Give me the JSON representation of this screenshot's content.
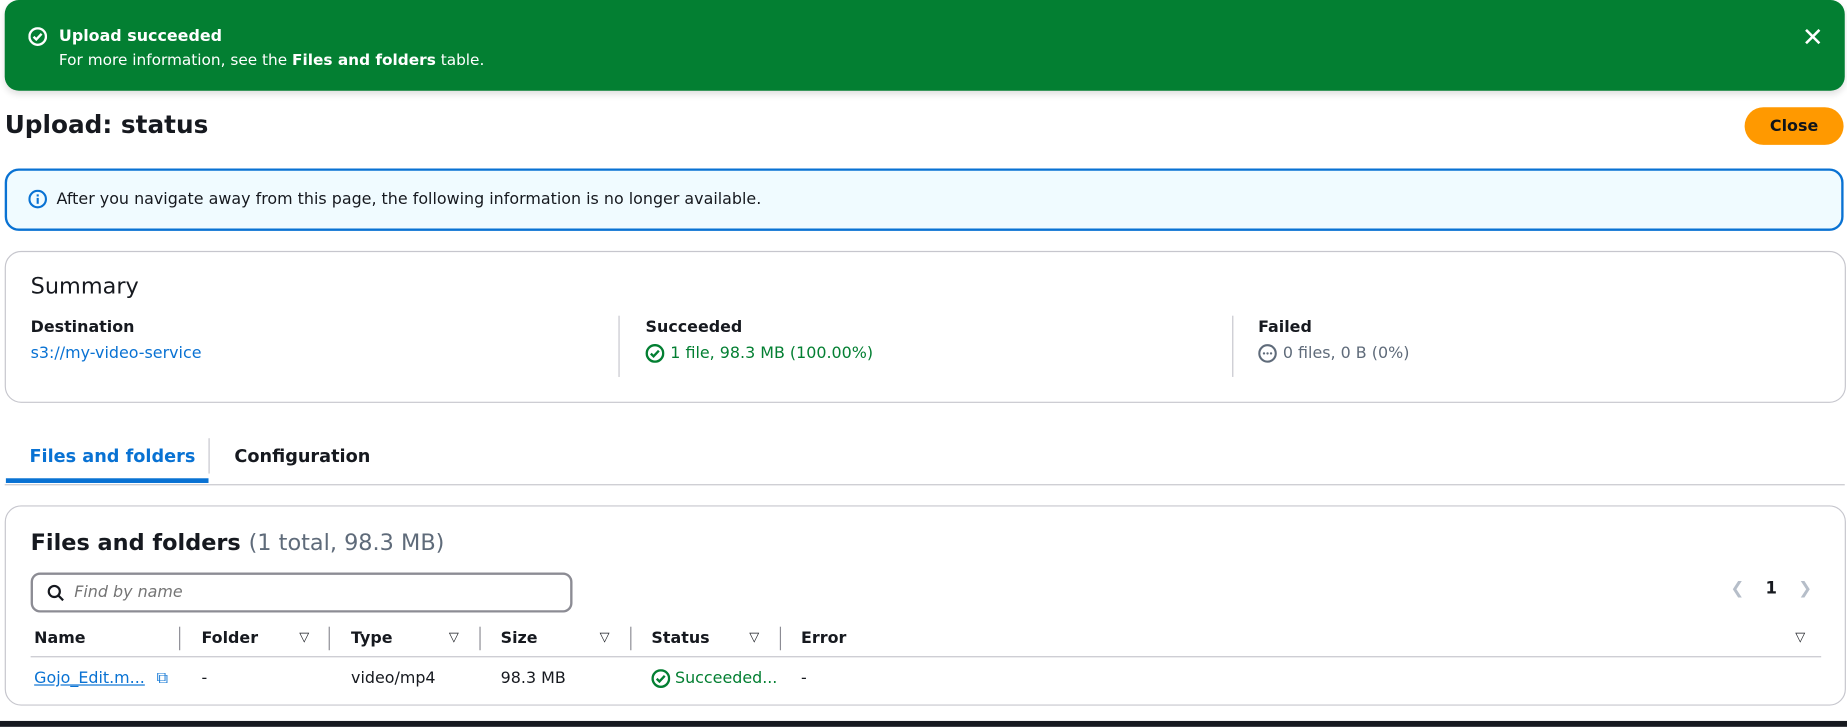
{
  "flash": {
    "title": "Upload succeeded",
    "desc_pre": "For more information, see the ",
    "desc_bold": "Files and folders",
    "desc_post": " table.",
    "icon": "check-circle-icon",
    "color": "#037f32"
  },
  "header": {
    "title": "Upload: status",
    "close_label": "Close"
  },
  "info": {
    "text": "After you navigate away from this page, the following information is no longer available."
  },
  "summary": {
    "title": "Summary",
    "destination_label": "Destination",
    "destination_value": "s3://my-video-service",
    "succeeded_label": "Succeeded",
    "succeeded_value": "1 file, 98.3 MB (100.00%)",
    "failed_label": "Failed",
    "failed_value": "0 files, 0 B (0%)"
  },
  "tabs": [
    {
      "label": "Files and folders",
      "active": true
    },
    {
      "label": "Configuration",
      "active": false
    }
  ],
  "files": {
    "title": "Files and folders",
    "count": "(1 total, 98.3 MB)",
    "search_placeholder": "Find by name",
    "page": "1",
    "columns": [
      "Name",
      "Folder",
      "Type",
      "Size",
      "Status",
      "Error"
    ],
    "rows": [
      {
        "name": "Gojo_Edit.m...",
        "folder": "-",
        "type": "video/mp4",
        "size": "98.3 MB",
        "status": "Succeeded...",
        "error": "-"
      }
    ]
  }
}
